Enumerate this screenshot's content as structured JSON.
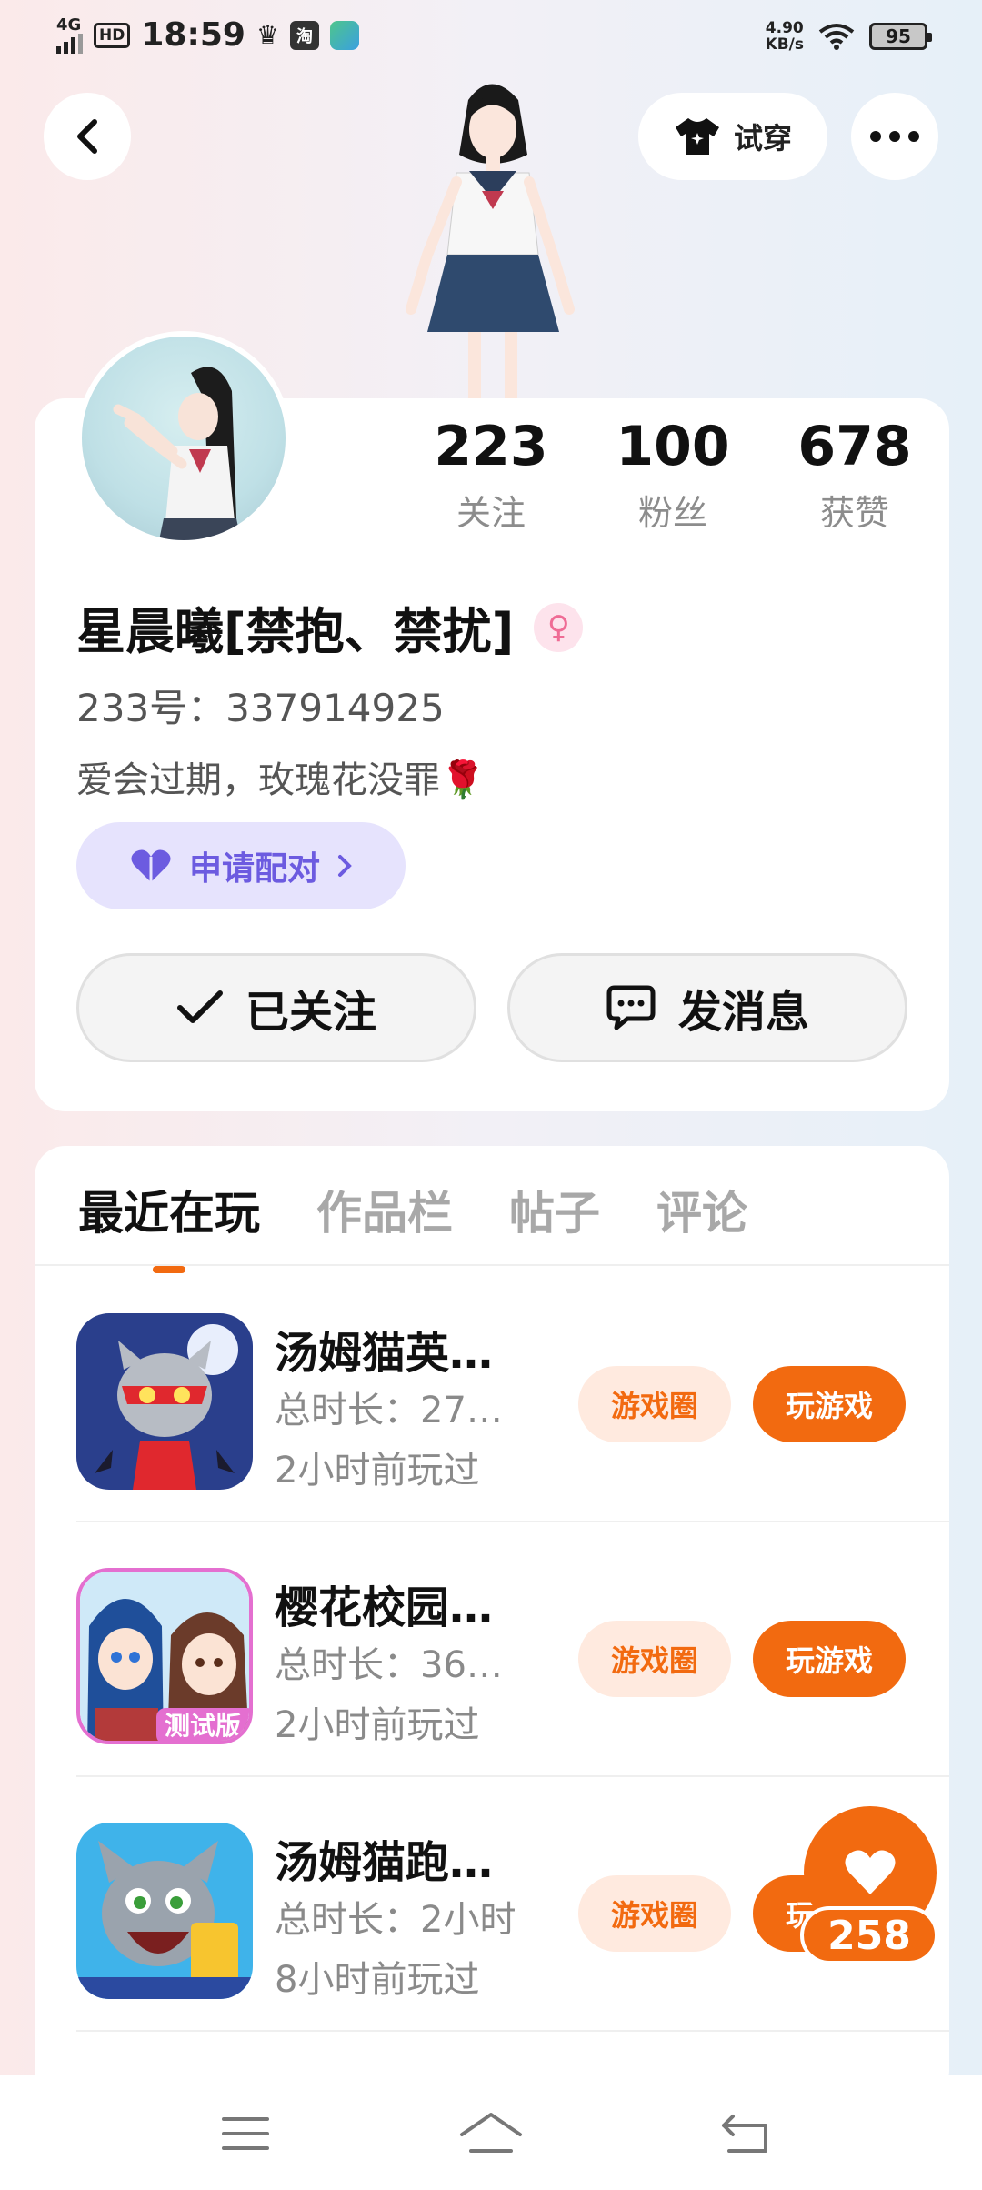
{
  "status_bar": {
    "network": "4G",
    "hd": "HD",
    "time": "18:59",
    "taobao_glyph": "淘",
    "speed_value": "4.90",
    "speed_unit": "KB/s",
    "battery": "95"
  },
  "header": {
    "back_icon": "back-arrow-icon",
    "try_on_label": "试穿",
    "more_icon": "more-dots-icon"
  },
  "profile": {
    "stats": [
      {
        "value": "223",
        "label": "关注"
      },
      {
        "value": "100",
        "label": "粉丝"
      },
      {
        "value": "678",
        "label": "获赞"
      }
    ],
    "name": "星晨曦[禁抱、禁扰]",
    "gender_icon": "female-icon",
    "uid": "233号：337914925",
    "bio": "爱会过期，玫瑰花没罪🌹",
    "pair_label": "申请配对",
    "follow_label": "已关注",
    "message_label": "发消息"
  },
  "tabs": [
    "最近在玩",
    "作品栏",
    "帖子",
    "评论"
  ],
  "games": [
    {
      "title": "汤姆猫英…",
      "duration": "总时长：27…",
      "last_played": "2小时前玩过",
      "circle_label": "游戏圈",
      "play_label": "玩游戏"
    },
    {
      "title": "樱花校园…",
      "duration": "总时长：36…",
      "last_played": "2小时前玩过",
      "circle_label": "游戏圈",
      "play_label": "玩游戏"
    },
    {
      "title": "汤姆猫跑…",
      "duration": "总时长：2小时",
      "last_played": "8小时前玩过",
      "circle_label": "游戏圈",
      "play_label": "玩游戏"
    }
  ],
  "game2_badge": "测试版",
  "like_float": {
    "count": "258"
  },
  "colors": {
    "accent": "#f26a10",
    "pair_bg": "#e6e3fd",
    "pair_text": "#6c5be0"
  }
}
